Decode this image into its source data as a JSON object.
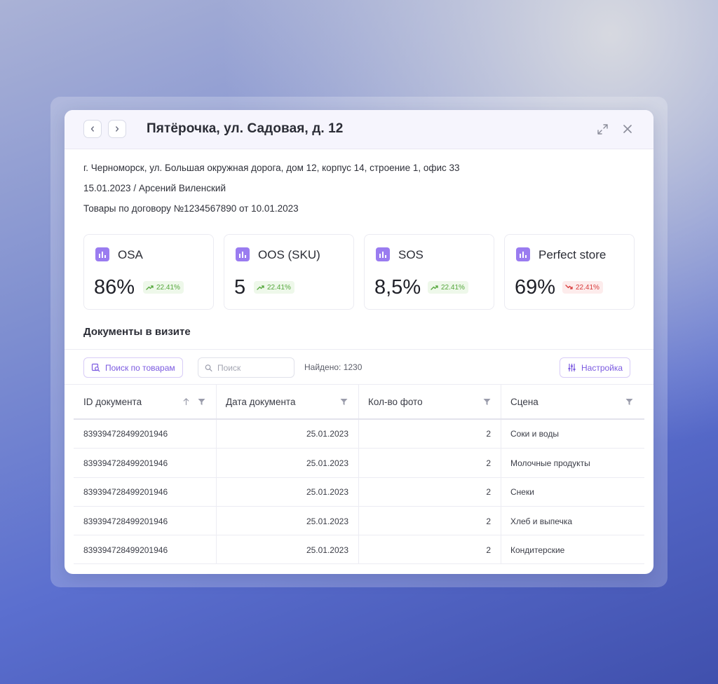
{
  "modal": {
    "title": "Пятёрочка, ул. Садовая, д. 12",
    "address": "г. Черноморск, ул. Большая окружная дорога, дом 12, корпус 14, строение 1, офис 33",
    "visit": "15.01.2023 / Арсений Виленский",
    "contract": "Товары по договору №1234567890 от 10.01.2023"
  },
  "metrics": [
    {
      "name": "OSA",
      "value": "86%",
      "change": "22.41%",
      "trend": "up"
    },
    {
      "name": "OOS (SKU)",
      "value": "5",
      "change": "22.41%",
      "trend": "up"
    },
    {
      "name": "SOS",
      "value": "8,5%",
      "change": "22.41%",
      "trend": "up"
    },
    {
      "name": "Perfect store",
      "value": "69%",
      "change": "22.41%",
      "trend": "down"
    }
  ],
  "documents": {
    "section_title": "Документы в визите",
    "search_products_label": "Поиск по товарам",
    "search_placeholder": "Поиск",
    "found_label": "Найдено: 1230",
    "settings_label": "Настройка",
    "columns": [
      "ID документа",
      "Дата документа",
      "Кол-во фото",
      "Сцена"
    ],
    "rows": [
      [
        "839394728499201946",
        "25.01.2023",
        "2",
        "Соки и воды"
      ],
      [
        "839394728499201946",
        "25.01.2023",
        "2",
        "Молочные продукты"
      ],
      [
        "839394728499201946",
        "25.01.2023",
        "2",
        "Снеки"
      ],
      [
        "839394728499201946",
        "25.01.2023",
        "2",
        "Хлеб и выпечка"
      ],
      [
        "839394728499201946",
        "25.01.2023",
        "2",
        "Кондитерские"
      ]
    ]
  },
  "colors": {
    "accent": "#7b5ae0",
    "trend_up": "#55a73c",
    "trend_down": "#d83b3b"
  }
}
